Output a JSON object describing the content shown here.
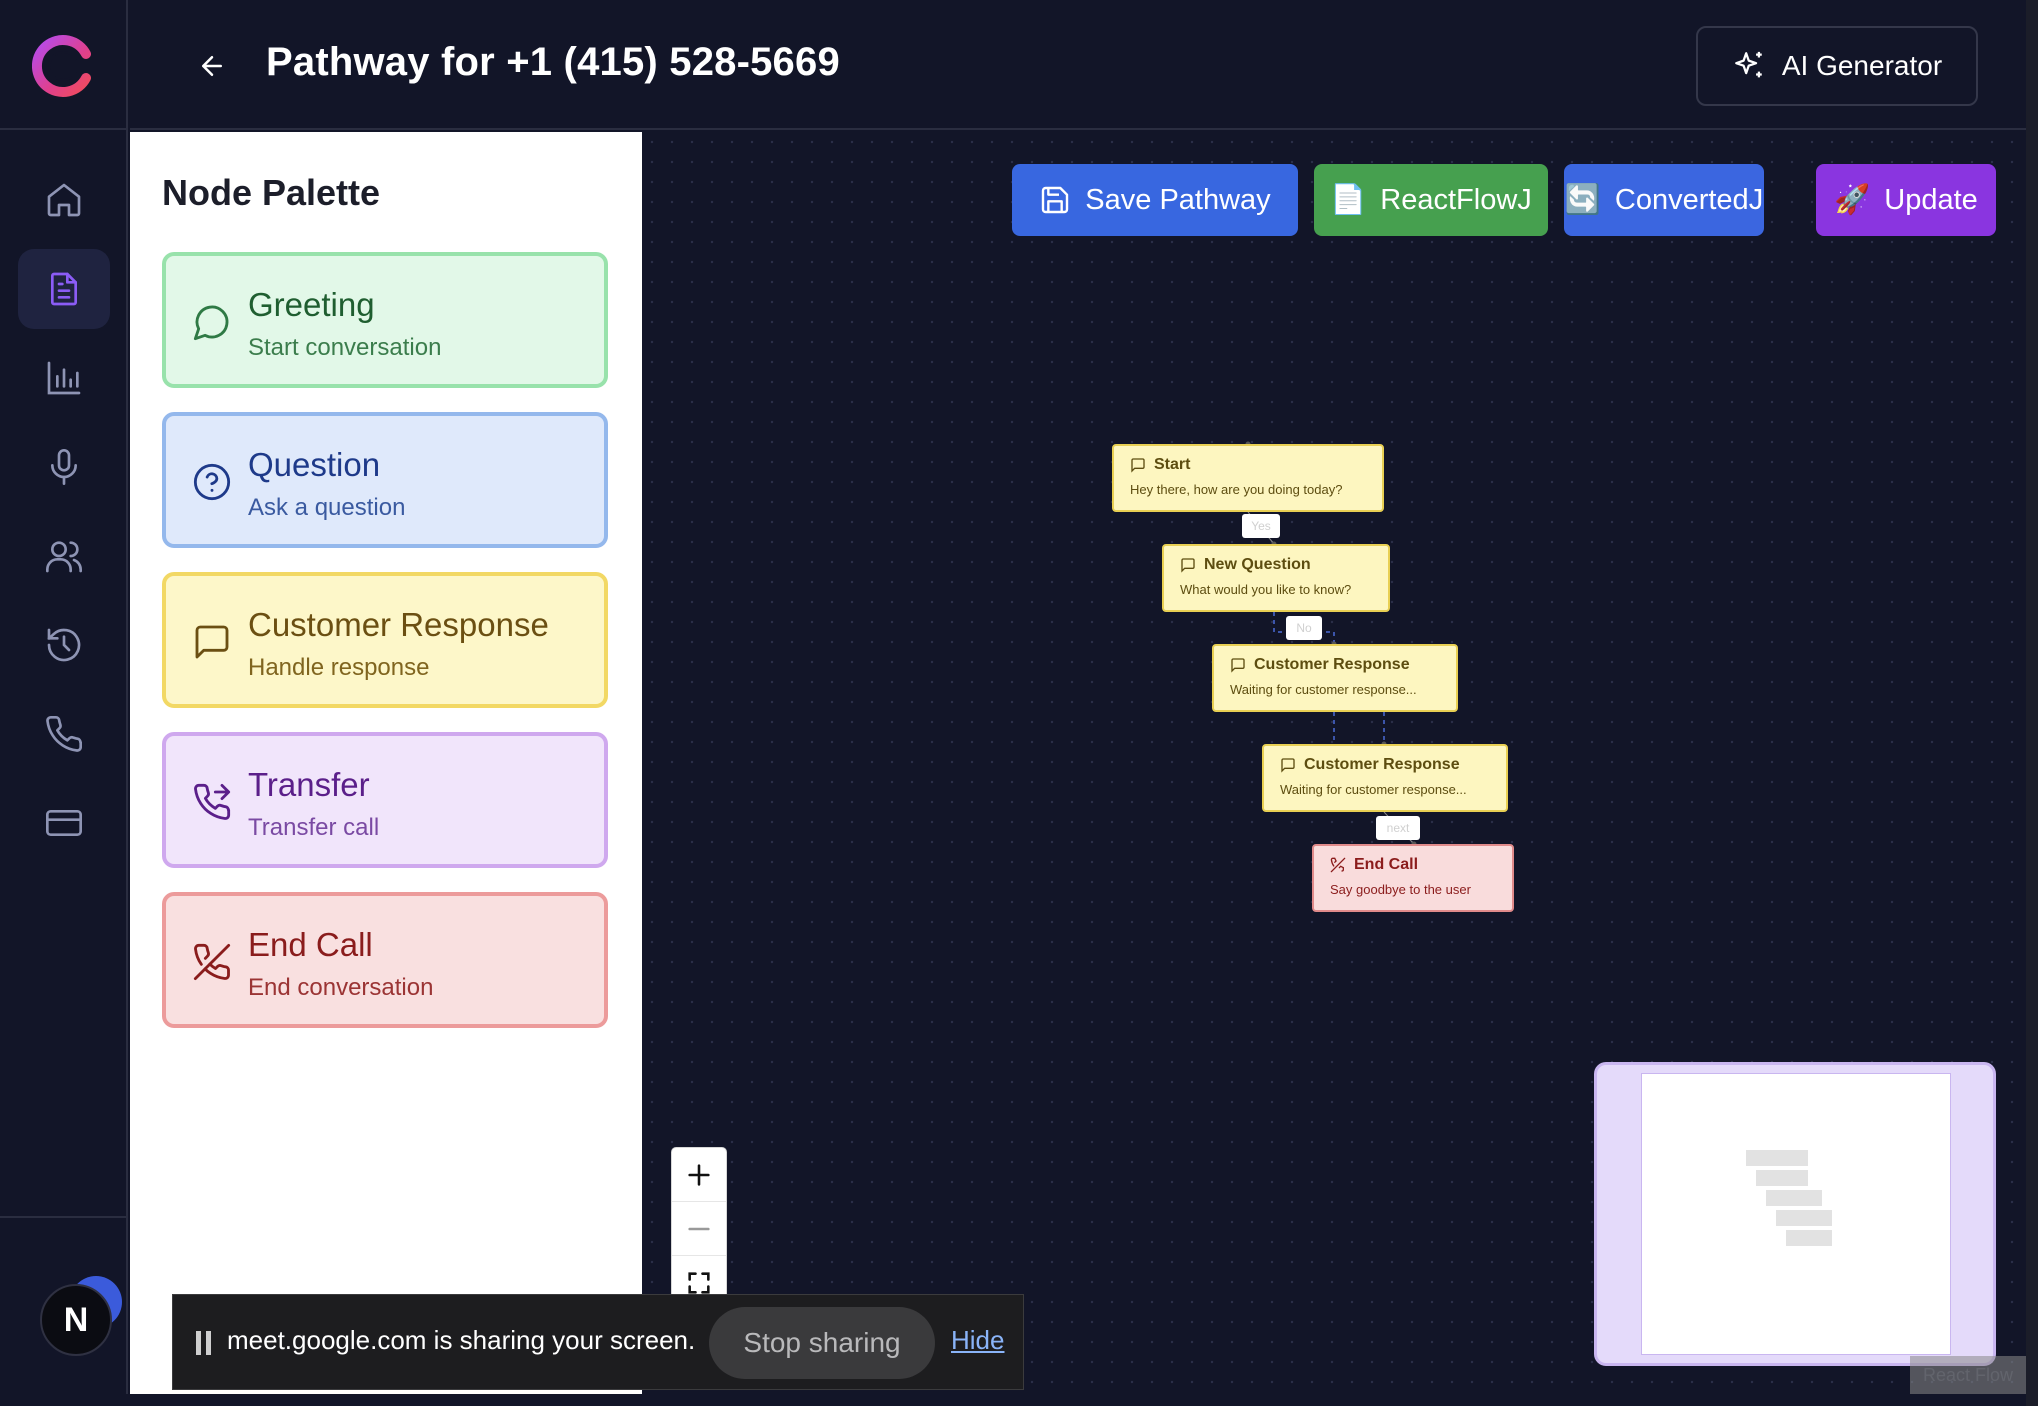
{
  "header": {
    "title": "Pathway for +1 (415) 528-5669",
    "ai_generator_label": "AI Generator"
  },
  "sidebar": {
    "items": [
      {
        "icon": "home-icon",
        "active": false
      },
      {
        "icon": "document-icon",
        "active": true
      },
      {
        "icon": "bar-chart-icon",
        "active": false
      },
      {
        "icon": "microphone-icon",
        "active": false
      },
      {
        "icon": "users-icon",
        "active": false
      },
      {
        "icon": "history-icon",
        "active": false
      },
      {
        "icon": "phone-icon",
        "active": false
      },
      {
        "icon": "credit-card-icon",
        "active": false
      }
    ],
    "avatar_initial": "N"
  },
  "palette": {
    "title": "Node Palette",
    "items": [
      {
        "title": "Greeting",
        "subtitle": "Start conversation",
        "icon": "chat-bubble-icon",
        "bg": "#e2f8e8",
        "border": "#98e2ab",
        "title_color": "#1f5e30",
        "sub_color": "#3b7d4c"
      },
      {
        "title": "Question",
        "subtitle": "Ask a question",
        "icon": "question-circle-icon",
        "bg": "#dfe9fb",
        "border": "#94b8ec",
        "title_color": "#1e3a8a",
        "sub_color": "#3a5aa0"
      },
      {
        "title": "Customer Response",
        "subtitle": "Handle response",
        "icon": "message-square-icon",
        "bg": "#fdf7c9",
        "border": "#f2d864",
        "title_color": "#6b4f12",
        "sub_color": "#80651f"
      },
      {
        "title": "Transfer",
        "subtitle": "Transfer call",
        "icon": "phone-forward-icon",
        "bg": "#f1e5fb",
        "border": "#cfa8ee",
        "title_color": "#5b1f8a",
        "sub_color": "#7a4aa3"
      },
      {
        "title": "End Call",
        "subtitle": "End conversation",
        "icon": "phone-off-icon",
        "bg": "#f9e0e0",
        "border": "#ec9b9b",
        "title_color": "#8a1c1c",
        "sub_color": "#9b3434"
      }
    ]
  },
  "toolbar": {
    "save_label": "Save Pathway",
    "reactflow_label": "ReactFlowJ",
    "reactflow_emoji": "📄",
    "converted_label": "ConvertedJ",
    "converted_emoji": "🔄",
    "update_label": "Update",
    "update_emoji": "🚀",
    "colors": {
      "save": "#3867e0",
      "reactflow": "#46a04f",
      "converted": "#3b66e0",
      "update": "#8a35e0"
    }
  },
  "flow": {
    "nodes": [
      {
        "title": "Start",
        "text": "Hey there, how are you doing today?",
        "kind": "yellow"
      },
      {
        "title": "New Question",
        "text": "What would you like to know?",
        "kind": "yellow"
      },
      {
        "title": "Customer Response",
        "text": "Waiting for customer response...",
        "kind": "yellow"
      },
      {
        "title": "Customer Response",
        "text": "Waiting for customer response...",
        "kind": "yellow"
      },
      {
        "title": "End Call",
        "text": "Say goodbye to the user",
        "kind": "red"
      }
    ],
    "edge_labels": [
      "Yes",
      "No",
      "next"
    ]
  },
  "minimap": {
    "attribution": "React Flow"
  },
  "share_banner": {
    "message": "meet.google.com is sharing your screen.",
    "stop_label": "Stop sharing",
    "hide_label": "Hide"
  }
}
